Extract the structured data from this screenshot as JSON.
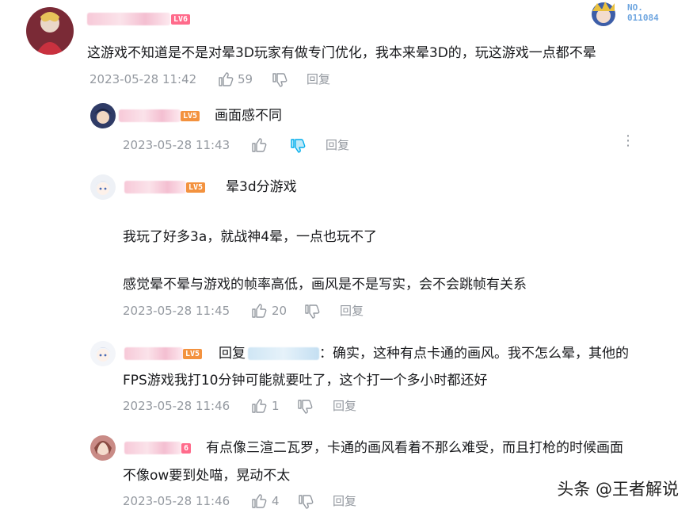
{
  "colors": {
    "text": "#18191c",
    "meta": "#9499a0",
    "level_top": "#ff6b8b",
    "level_sub": "#f3923f",
    "dislike_active": "#00aeec"
  },
  "top_comment": {
    "level": "LV6",
    "text": "这游戏不知道是不是对晕3D玩家有做专门优化，我本来晕3D的，玩这游戏一点都不晕",
    "time": "2023-05-28 11:42",
    "likes": "59",
    "reply_label": "回复"
  },
  "badge": {
    "label": "NO.",
    "number": "011084"
  },
  "replies": [
    {
      "level": "LV5",
      "text": "画面感不同",
      "time": "2023-05-28 11:43",
      "likes": "",
      "reply_label": "回复"
    },
    {
      "level": "LV5",
      "text": "晕3d分游戏",
      "body_lines": [
        "我玩了好多3a，就战神4晕，一点也玩不了",
        "感觉晕不晕与游戏的帧率高低，画风是不是写实，会不会跳帧有关系"
      ],
      "time": "2023-05-28 11:45",
      "likes": "20",
      "reply_label": "回复"
    },
    {
      "level": "LV5",
      "prefix": "回复",
      "text_after": "：确实，这种有点卡通的画风。我不怎么晕，其他的",
      "line2": "FPS游戏我打10分钟可能就要吐了，这个打一个多小时都还好",
      "time": "2023-05-28 11:46",
      "likes": "1",
      "reply_label": "回复"
    },
    {
      "level": "6",
      "text": "有点像三渲二瓦罗，卡通的画风看着不那么难受，而且打枪的时候画面",
      "line2": "不像ow要到处喵，晃动不太",
      "time": "2023-05-28 11:46",
      "likes": "4",
      "reply_label": "回复"
    }
  ],
  "watermark": "头条 @王者解说"
}
